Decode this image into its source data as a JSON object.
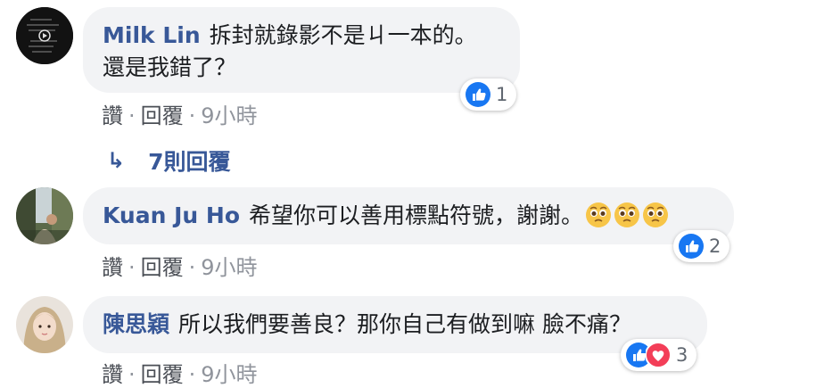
{
  "comments": [
    {
      "author": "Milk Lin",
      "text_line1": "拆封就錄影不是ㄐ一本的。",
      "text_line2": "還是我錯了？",
      "reaction_count": "1",
      "reactions": [
        "like-icon"
      ],
      "actions": {
        "like": "讚",
        "reply": "回覆",
        "time": "9小時"
      }
    },
    {
      "author": "Kuan Ju Ho",
      "text": "希望你可以善用標點符號，謝謝。",
      "emojis": [
        "pleading-face-icon",
        "pleading-face-icon",
        "pleading-face-icon"
      ],
      "reaction_count": "2",
      "reactions": [
        "like-icon"
      ],
      "actions": {
        "like": "讚",
        "reply": "回覆",
        "time": "9小時"
      }
    },
    {
      "author": "陳思穎",
      "text": "所以我們要善良？那你自己有做到嘛 臉不痛？",
      "reaction_count": "3",
      "reactions": [
        "like-icon",
        "love-icon"
      ],
      "actions": {
        "like": "讚",
        "reply": "回覆",
        "time": "9小時"
      }
    }
  ],
  "replies_link": "7則回覆",
  "colors": {
    "link": "#385898",
    "bubble": "#f2f3f5",
    "like": "#1877f2",
    "love": "#f33e58"
  }
}
